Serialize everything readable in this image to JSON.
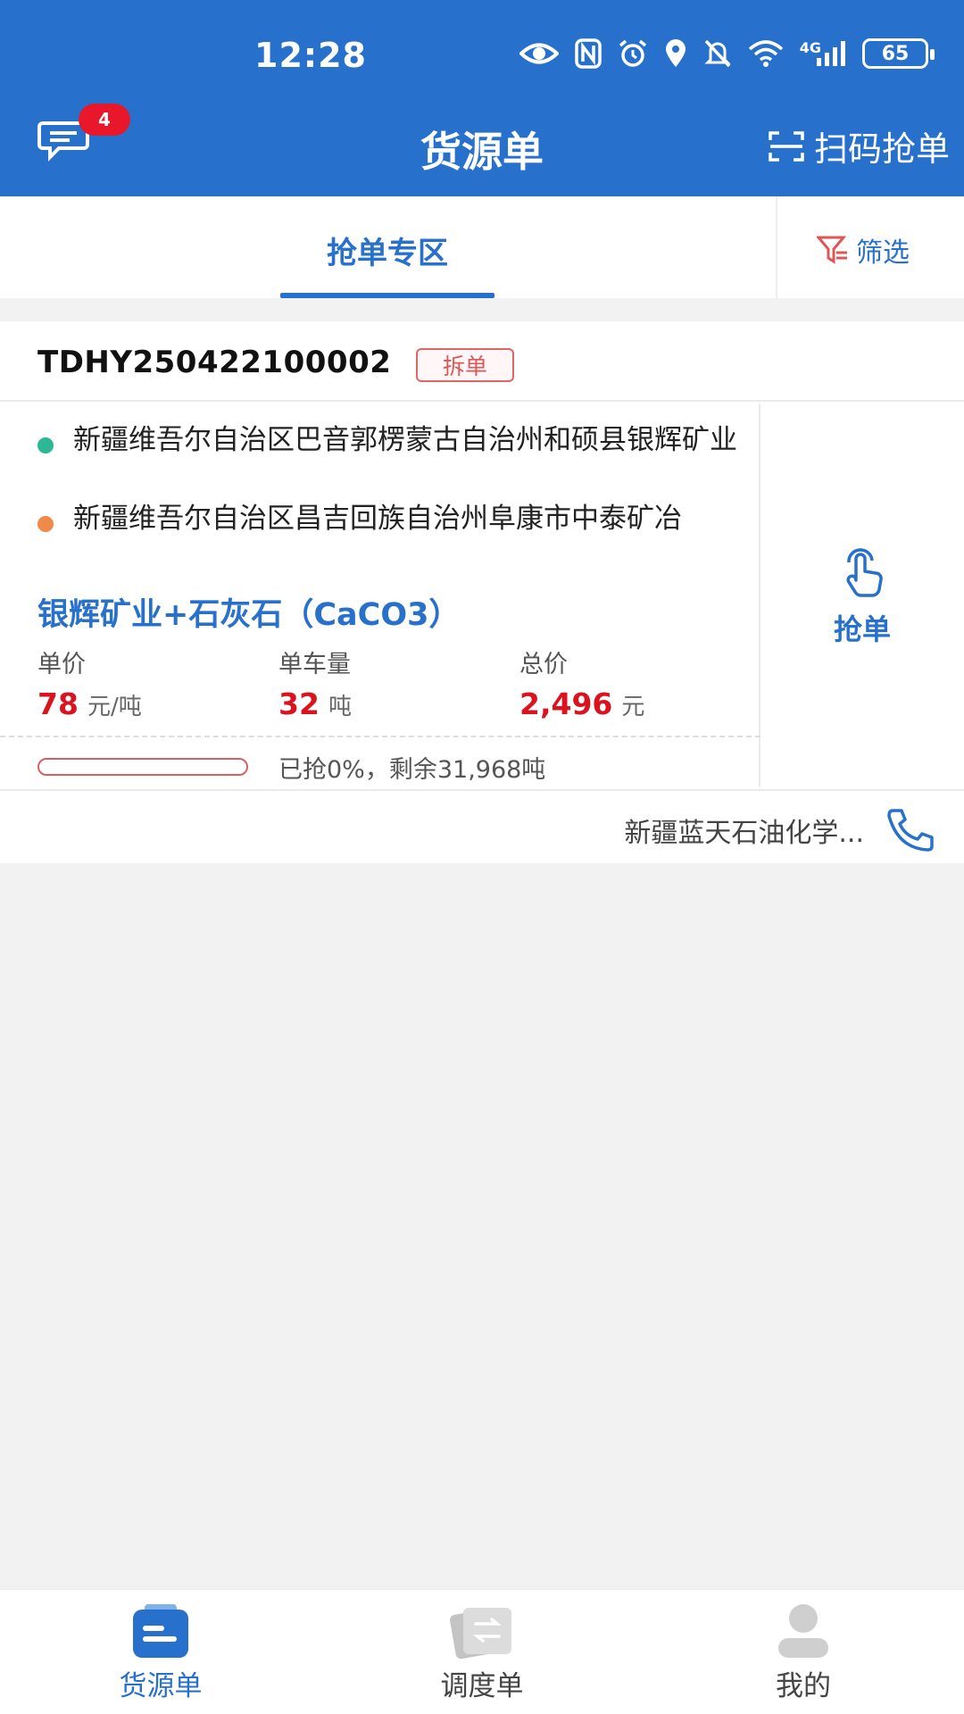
{
  "status_bar": {
    "time": "12:28",
    "network": "4G",
    "battery": "65",
    "icons": [
      "eye-icon",
      "nfc-icon",
      "alarm-icon",
      "location-icon",
      "mute-icon",
      "wifi-icon",
      "signal-icon",
      "battery-icon"
    ]
  },
  "header": {
    "title": "货源单",
    "message_badge": "4",
    "scan_label": "扫码抢单"
  },
  "tabs": {
    "active": "抢单专区",
    "filter_label": "筛选"
  },
  "order": {
    "number": "TDHY250422100002",
    "badge": "拆单",
    "from": "新疆维吾尔自治区巴音郭楞蒙古自治州和硕县银辉矿业",
    "to": "新疆维吾尔自治区昌吉回族自治州阜康市中泰矿冶",
    "goods": "银辉矿业+石灰石（CaCO3）",
    "unit_price_label": "单价",
    "unit_price": "78",
    "unit_price_unit": "元/吨",
    "truck_qty_label": "单车量",
    "truck_qty": "32",
    "truck_qty_unit": "吨",
    "total_label": "总价",
    "total": "2,496",
    "total_unit": "元",
    "progress_fraction": 0,
    "progress_text": "已抢0%，剩余31,968吨",
    "grab_label": "抢单",
    "company": "新疆蓝天石油化学..."
  },
  "bottom_nav": {
    "items": [
      {
        "label": "货源单",
        "active": true
      },
      {
        "label": "调度单",
        "active": false
      },
      {
        "label": "我的",
        "active": false
      }
    ]
  },
  "colors": {
    "primary": "#2770cc",
    "price_red": "#d9141f",
    "badge_red": "#e8182a",
    "origin_dot": "#2bb893",
    "dest_dot": "#f08a4a"
  }
}
